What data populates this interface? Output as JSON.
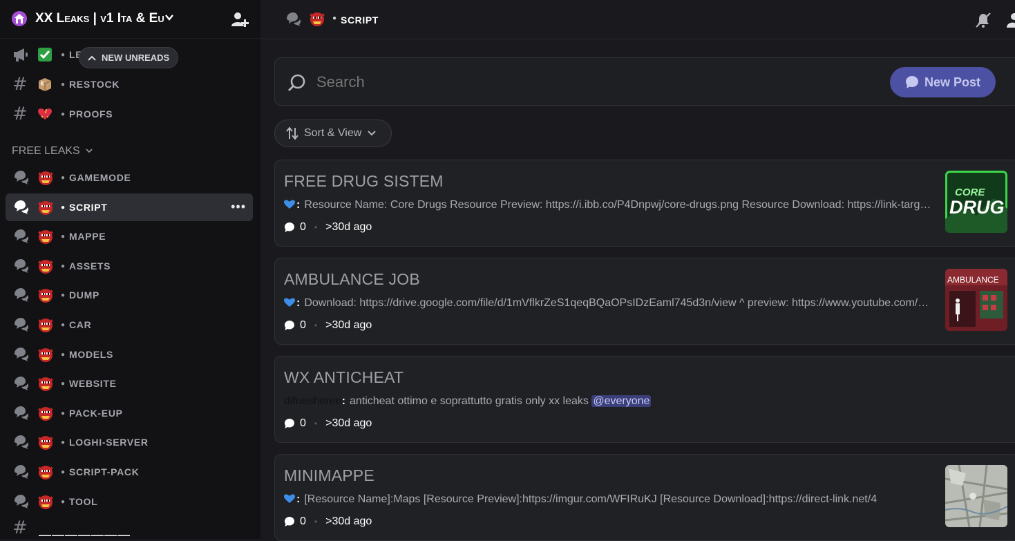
{
  "server": {
    "name": "XX Leaks | v1 Ita & Eu"
  },
  "sidebar": {
    "unreads_label": "NEW UNREADS",
    "top_channels": [
      {
        "name": "LEAKS-INFO",
        "visible_name": "LE",
        "icon": "megaphone-icon",
        "emoji": "check-emoji"
      },
      {
        "name": "RESTOCK",
        "icon": "hash-icon",
        "emoji": "package-emoji"
      },
      {
        "name": "PROOFS",
        "icon": "hash-icon",
        "emoji": "heart-emoji"
      }
    ],
    "category": "FREE LEAKS",
    "forum_channels": [
      {
        "name": "GAMEMODE"
      },
      {
        "name": "SCRIPT",
        "selected": true
      },
      {
        "name": "MAPPE"
      },
      {
        "name": "ASSETS"
      },
      {
        "name": "DUMP"
      },
      {
        "name": "CAR"
      },
      {
        "name": "MODELS"
      },
      {
        "name": "WEBSITE"
      },
      {
        "name": "PACK-EUP"
      },
      {
        "name": "LOGHI-SERVER"
      },
      {
        "name": "SCRIPT-PACK"
      },
      {
        "name": "TOOL"
      }
    ],
    "bottom_channel": {
      "name": "———————",
      "icon": "hash-icon"
    }
  },
  "topbar": {
    "channel_name": "SCRIPT"
  },
  "search": {
    "placeholder": "Search"
  },
  "new_post_label": "New Post",
  "sort_view_label": "Sort & View",
  "posts": [
    {
      "title": "FREE DRUG SISTEM",
      "body": "Resource Name: Core Drugs Resource Preview: https://i.ibb.co/P4Dnpwj/core-drugs.png Resource Download: https://link-target.net/",
      "prefix": "blue-heart",
      "replies": "0",
      "age": ">30d ago",
      "thumb_text": "CORE DRUGS"
    },
    {
      "title": "AMBULANCE JOB",
      "body": "Download: https://drive.google.com/file/d/1mVflkrZeS1qeqBQaOPsIDzEaml745d3n/view ^ preview: https://www.youtube.com/watch",
      "prefix": "blue-heart",
      "replies": "0",
      "age": ">30d ago",
      "thumb_text": "AMBULANCE"
    },
    {
      "title": "WX ANTICHEAT",
      "author": "difuesheree",
      "body": "anticheat ottimo e soprattutto gratis only xx leaks",
      "mention": "@everyone",
      "replies": "0",
      "age": ">30d ago"
    },
    {
      "title": "MINIMAPPE",
      "body": "[Resource Name]:Maps [Resource Preview]:https://imgur.com/WFIRuKJ [Resource Download]:https://direct-link.net/4",
      "prefix": "blue-heart",
      "replies": "0",
      "age": ">30d ago"
    }
  ],
  "colors": {
    "sidebar_bg": "#121214",
    "main_bg": "#1a1a1e",
    "selected_channel_bg": "#2e2f35",
    "new_post_button": "#4c51a3",
    "mention_bg": "#3b3f79",
    "blue_heart": "#3e8ee8"
  }
}
